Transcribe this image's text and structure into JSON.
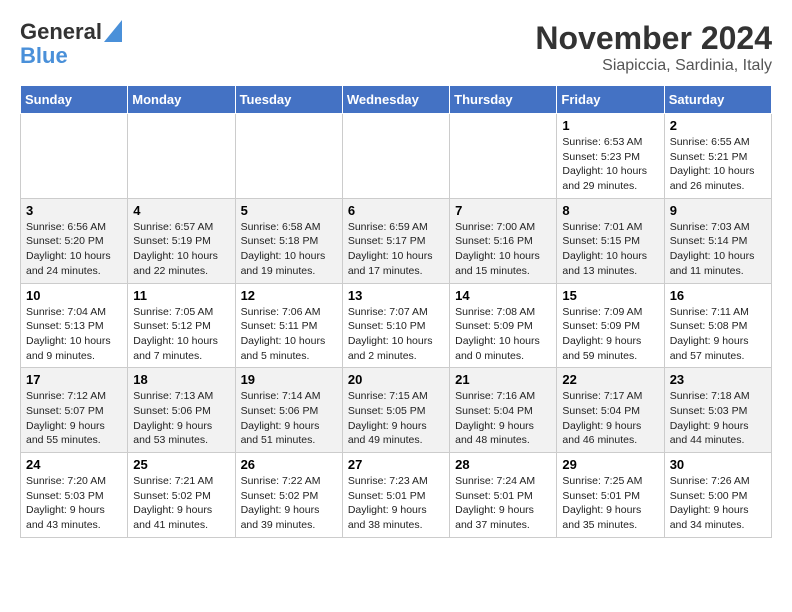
{
  "header": {
    "logo_line1": "General",
    "logo_line2": "Blue",
    "month": "November 2024",
    "location": "Siapiccia, Sardinia, Italy"
  },
  "days_of_week": [
    "Sunday",
    "Monday",
    "Tuesday",
    "Wednesday",
    "Thursday",
    "Friday",
    "Saturday"
  ],
  "weeks": [
    [
      {
        "day": "",
        "info": ""
      },
      {
        "day": "",
        "info": ""
      },
      {
        "day": "",
        "info": ""
      },
      {
        "day": "",
        "info": ""
      },
      {
        "day": "",
        "info": ""
      },
      {
        "day": "1",
        "info": "Sunrise: 6:53 AM\nSunset: 5:23 PM\nDaylight: 10 hours and 29 minutes."
      },
      {
        "day": "2",
        "info": "Sunrise: 6:55 AM\nSunset: 5:21 PM\nDaylight: 10 hours and 26 minutes."
      }
    ],
    [
      {
        "day": "3",
        "info": "Sunrise: 6:56 AM\nSunset: 5:20 PM\nDaylight: 10 hours and 24 minutes."
      },
      {
        "day": "4",
        "info": "Sunrise: 6:57 AM\nSunset: 5:19 PM\nDaylight: 10 hours and 22 minutes."
      },
      {
        "day": "5",
        "info": "Sunrise: 6:58 AM\nSunset: 5:18 PM\nDaylight: 10 hours and 19 minutes."
      },
      {
        "day": "6",
        "info": "Sunrise: 6:59 AM\nSunset: 5:17 PM\nDaylight: 10 hours and 17 minutes."
      },
      {
        "day": "7",
        "info": "Sunrise: 7:00 AM\nSunset: 5:16 PM\nDaylight: 10 hours and 15 minutes."
      },
      {
        "day": "8",
        "info": "Sunrise: 7:01 AM\nSunset: 5:15 PM\nDaylight: 10 hours and 13 minutes."
      },
      {
        "day": "9",
        "info": "Sunrise: 7:03 AM\nSunset: 5:14 PM\nDaylight: 10 hours and 11 minutes."
      }
    ],
    [
      {
        "day": "10",
        "info": "Sunrise: 7:04 AM\nSunset: 5:13 PM\nDaylight: 10 hours and 9 minutes."
      },
      {
        "day": "11",
        "info": "Sunrise: 7:05 AM\nSunset: 5:12 PM\nDaylight: 10 hours and 7 minutes."
      },
      {
        "day": "12",
        "info": "Sunrise: 7:06 AM\nSunset: 5:11 PM\nDaylight: 10 hours and 5 minutes."
      },
      {
        "day": "13",
        "info": "Sunrise: 7:07 AM\nSunset: 5:10 PM\nDaylight: 10 hours and 2 minutes."
      },
      {
        "day": "14",
        "info": "Sunrise: 7:08 AM\nSunset: 5:09 PM\nDaylight: 10 hours and 0 minutes."
      },
      {
        "day": "15",
        "info": "Sunrise: 7:09 AM\nSunset: 5:09 PM\nDaylight: 9 hours and 59 minutes."
      },
      {
        "day": "16",
        "info": "Sunrise: 7:11 AM\nSunset: 5:08 PM\nDaylight: 9 hours and 57 minutes."
      }
    ],
    [
      {
        "day": "17",
        "info": "Sunrise: 7:12 AM\nSunset: 5:07 PM\nDaylight: 9 hours and 55 minutes."
      },
      {
        "day": "18",
        "info": "Sunrise: 7:13 AM\nSunset: 5:06 PM\nDaylight: 9 hours and 53 minutes."
      },
      {
        "day": "19",
        "info": "Sunrise: 7:14 AM\nSunset: 5:06 PM\nDaylight: 9 hours and 51 minutes."
      },
      {
        "day": "20",
        "info": "Sunrise: 7:15 AM\nSunset: 5:05 PM\nDaylight: 9 hours and 49 minutes."
      },
      {
        "day": "21",
        "info": "Sunrise: 7:16 AM\nSunset: 5:04 PM\nDaylight: 9 hours and 48 minutes."
      },
      {
        "day": "22",
        "info": "Sunrise: 7:17 AM\nSunset: 5:04 PM\nDaylight: 9 hours and 46 minutes."
      },
      {
        "day": "23",
        "info": "Sunrise: 7:18 AM\nSunset: 5:03 PM\nDaylight: 9 hours and 44 minutes."
      }
    ],
    [
      {
        "day": "24",
        "info": "Sunrise: 7:20 AM\nSunset: 5:03 PM\nDaylight: 9 hours and 43 minutes."
      },
      {
        "day": "25",
        "info": "Sunrise: 7:21 AM\nSunset: 5:02 PM\nDaylight: 9 hours and 41 minutes."
      },
      {
        "day": "26",
        "info": "Sunrise: 7:22 AM\nSunset: 5:02 PM\nDaylight: 9 hours and 39 minutes."
      },
      {
        "day": "27",
        "info": "Sunrise: 7:23 AM\nSunset: 5:01 PM\nDaylight: 9 hours and 38 minutes."
      },
      {
        "day": "28",
        "info": "Sunrise: 7:24 AM\nSunset: 5:01 PM\nDaylight: 9 hours and 37 minutes."
      },
      {
        "day": "29",
        "info": "Sunrise: 7:25 AM\nSunset: 5:01 PM\nDaylight: 9 hours and 35 minutes."
      },
      {
        "day": "30",
        "info": "Sunrise: 7:26 AM\nSunset: 5:00 PM\nDaylight: 9 hours and 34 minutes."
      }
    ]
  ]
}
